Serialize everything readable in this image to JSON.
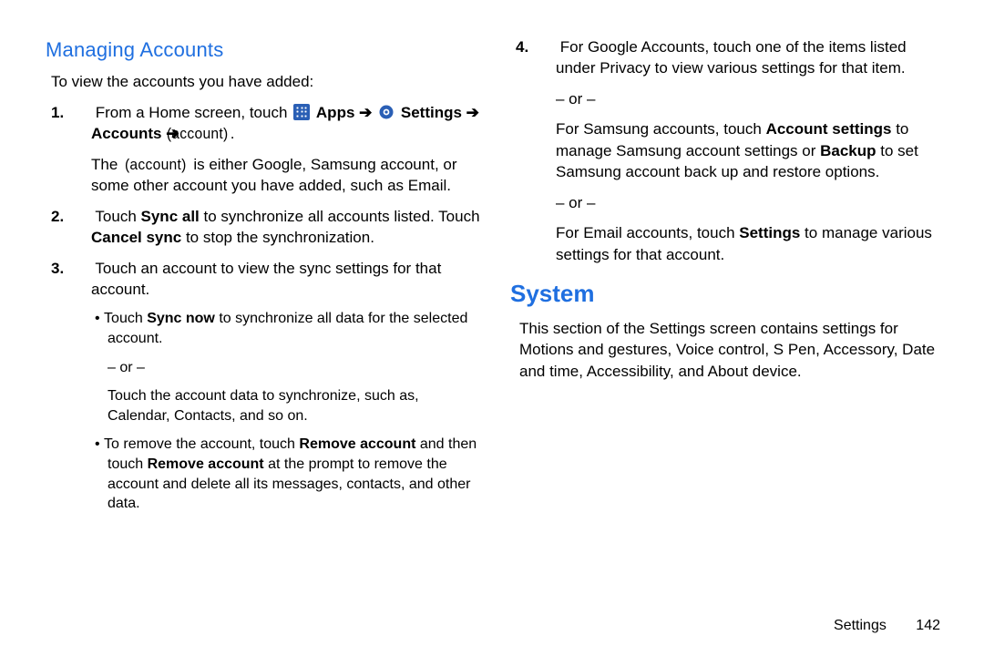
{
  "left": {
    "heading": "Managing Accounts",
    "intro": "To view the accounts you have added:",
    "step1_pre": "From a Home screen, touch",
    "apps_label": "Apps",
    "settings_label": "Settings",
    "accounts_label": "Accounts",
    "arrow": "➔",
    "account_ph": "(account)",
    "step1_para2a": "The",
    "step1_para2b": "is either Google, Samsung account, or some other account you have added, such as Email.",
    "step2_a": "Touch ",
    "sync_all": "Sync all",
    "step2_b": " to synchronize all accounts listed. Touch ",
    "cancel_sync": "Cancel sync",
    "step2_c": " to stop the synchronization.",
    "step3": "Touch an account to view the sync settings for that account.",
    "bullet1_a": "Touch ",
    "sync_now": "Sync now",
    "bullet1_b": " to synchronize all data for the selected account.",
    "or": "– or –",
    "bullet1_sub": "Touch the account data to synchronize, such as, Calendar, Contacts, and so on.",
    "bullet2_a": "To remove the account, touch ",
    "remove_account": "Remove account",
    "bullet2_b": " and then touch ",
    "bullet2_c": " at the prompt to remove the account and delete all its messages, contacts, and other data."
  },
  "right": {
    "step4_a": "For Google Accounts, touch one of the items listed under Privacy to view various settings for that item.",
    "or": "– or –",
    "step4_b_pre": "For Samsung accounts, touch ",
    "account_settings": "Account settings",
    "step4_b_mid": " to manage Samsung account settings or ",
    "backup": "Backup",
    "step4_b_post": " to set Samsung account back up and restore options.",
    "step4_c_pre": "For Email accounts, touch ",
    "settings_bold": "Settings",
    "step4_c_post": " to manage various settings for that account.",
    "system_heading": "System",
    "system_body": "This section of the Settings screen contains settings for Motions and gestures, Voice control, S Pen, Accessory, Date and time, Accessibility, and About device."
  },
  "footer": {
    "section": "Settings",
    "page": "142"
  }
}
